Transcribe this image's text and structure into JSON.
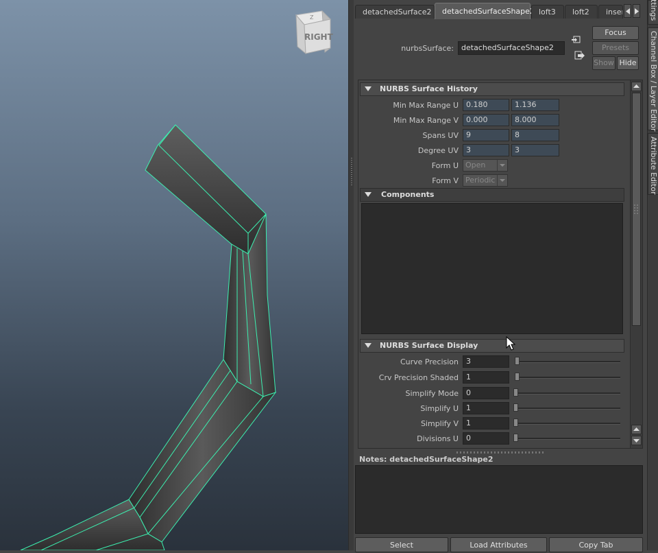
{
  "viewport": {
    "viewcube_label": "RIGHT",
    "viewcube_small": "Z",
    "highlight_color": "#3cf0b0"
  },
  "tabs": [
    {
      "label": "detachedSurface2",
      "active": false
    },
    {
      "label": "detachedSurfaceShape2",
      "active": true
    },
    {
      "label": "loft3",
      "active": false
    },
    {
      "label": "loft2",
      "active": false
    },
    {
      "label": "inser",
      "active": false
    }
  ],
  "header": {
    "node_type_label": "nurbsSurface:",
    "node_name": "detachedSurfaceShape2",
    "focus_label": "Focus",
    "presets_label": "Presets",
    "show_label": "Show",
    "hide_label": "Hide"
  },
  "history": {
    "title": "NURBS Surface History",
    "rows": [
      {
        "label": "Min Max Range U",
        "v1": "0.180",
        "v2": "1.136"
      },
      {
        "label": "Min Max Range V",
        "v1": "0.000",
        "v2": "8.000"
      },
      {
        "label": "Spans UV",
        "v1": "9",
        "v2": "8"
      },
      {
        "label": "Degree UV",
        "v1": "3",
        "v2": "3"
      }
    ],
    "form_u_label": "Form U",
    "form_u_value": "Open",
    "form_v_label": "Form V",
    "form_v_value": "Periodic"
  },
  "components": {
    "title": "Components"
  },
  "display": {
    "title": "NURBS Surface Display",
    "rows": [
      {
        "label": "Curve Precision",
        "value": "3"
      },
      {
        "label": "Crv Precision Shaded",
        "value": "1"
      },
      {
        "label": "Simplify Mode",
        "value": "0"
      },
      {
        "label": "Simplify U",
        "value": "1"
      },
      {
        "label": "Simplify V",
        "value": "1"
      },
      {
        "label": "Divisions U",
        "value": "0"
      }
    ]
  },
  "notes": {
    "label": "Notes:",
    "node": "detachedSurfaceShape2"
  },
  "bottom_buttons": {
    "select": "Select",
    "load": "Load Attributes",
    "copy": "Copy Tab"
  },
  "side_tabs": {
    "settings": "ttings",
    "channel_box": "Channel Box / Layer Editor",
    "attribute_editor": "Attribute Editor"
  }
}
